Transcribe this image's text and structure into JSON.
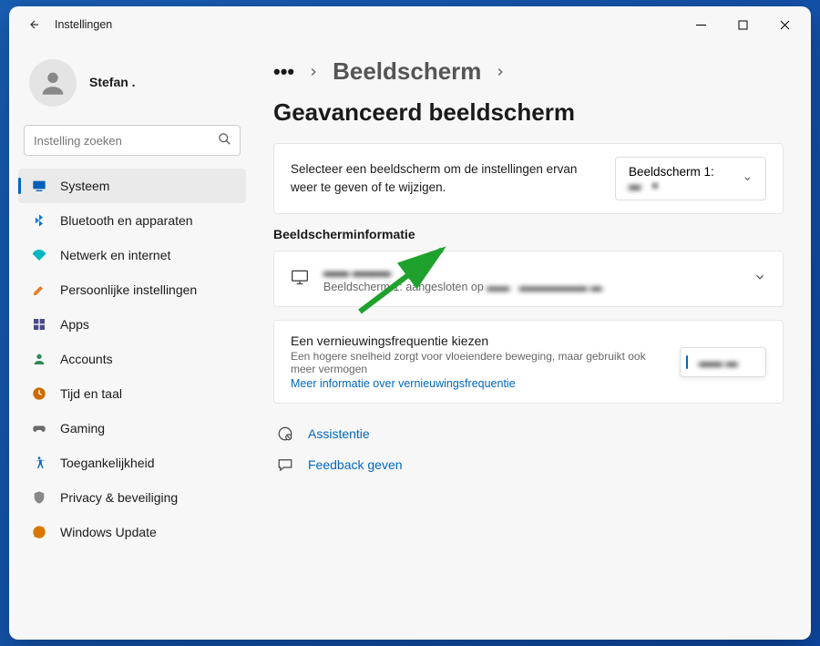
{
  "window": {
    "title": "Instellingen"
  },
  "profile": {
    "name": "Stefan .",
    "subtitle": ""
  },
  "search": {
    "placeholder": "Instelling zoeken"
  },
  "sidebar": {
    "items": [
      {
        "label": "Systeem",
        "icon": "system",
        "active": true
      },
      {
        "label": "Bluetooth en apparaten",
        "icon": "bluetooth"
      },
      {
        "label": "Netwerk en internet",
        "icon": "network"
      },
      {
        "label": "Persoonlijke instellingen",
        "icon": "personalize"
      },
      {
        "label": "Apps",
        "icon": "apps"
      },
      {
        "label": "Accounts",
        "icon": "accounts"
      },
      {
        "label": "Tijd en taal",
        "icon": "time"
      },
      {
        "label": "Gaming",
        "icon": "gaming"
      },
      {
        "label": "Toegankelijkheid",
        "icon": "accessibility"
      },
      {
        "label": "Privacy & beveiliging",
        "icon": "privacy"
      },
      {
        "label": "Windows Update",
        "icon": "update"
      }
    ]
  },
  "breadcrumb": {
    "parent": "Beeldscherm",
    "current": "Geavanceerd beeldscherm"
  },
  "select_display": {
    "description": "Selecteer een beeldscherm om de instellingen ervan weer te geven of te wijzigen.",
    "picker_label": "Beeldscherm 1:"
  },
  "display_info": {
    "section_title": "Beeldscherminformatie",
    "title": "",
    "subtitle": "Beeldscherm 1: aangesloten op"
  },
  "refresh_rate": {
    "title": "Een vernieuwingsfrequentie kiezen",
    "subtitle": "Een hogere snelheid zorgt voor vloeiendere beweging, maar gebruikt ook meer vermogen",
    "link": "Meer informatie over vernieuwingsfrequentie",
    "value": ""
  },
  "help": {
    "assistance": "Assistentie",
    "feedback": "Feedback geven"
  }
}
